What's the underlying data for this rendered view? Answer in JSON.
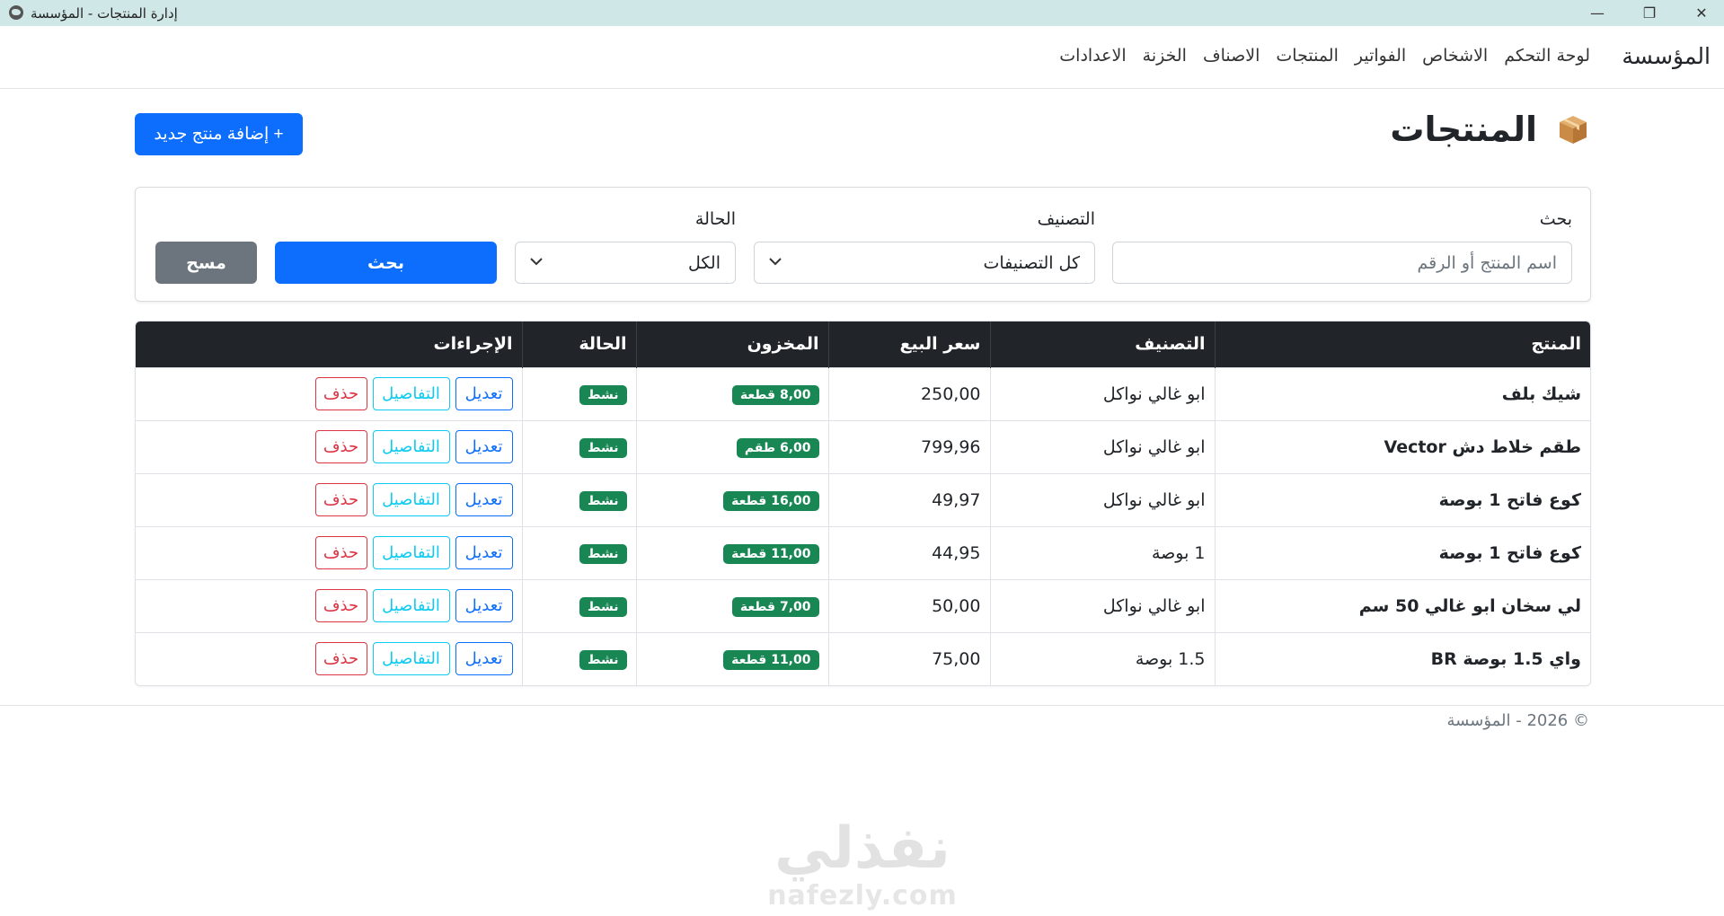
{
  "window": {
    "title": "إدارة المنتجات - المؤسسة",
    "minimize_glyph": "—",
    "maximize_glyph": "❐",
    "close_glyph": "✕"
  },
  "navbar": {
    "brand": "المؤسسة",
    "links": [
      "لوحة التحكم",
      "الاشخاص",
      "الفواتير",
      "المنتجات",
      "الاصناف",
      "الخزنة",
      "الاعدادات"
    ]
  },
  "header": {
    "icon": "package-box-icon",
    "title": "المنتجات",
    "add_button": "+ إضافة منتج جديد"
  },
  "filters": {
    "search_label": "بحث",
    "search_placeholder": "اسم المنتج أو الرقم",
    "category_label": "التصنيف",
    "category_value": "كل التصنيفات",
    "status_label": "الحالة",
    "status_value": "الكل",
    "search_button": "بحث",
    "clear_button": "مسح"
  },
  "table": {
    "headers": [
      "المنتج",
      "التصنيف",
      "سعر البيع",
      "المخزون",
      "الحالة",
      "الإجراءات"
    ],
    "rows": [
      {
        "name": "شيك بلف",
        "category": "ابو غالي نواكل",
        "price": "250,00",
        "stock": "8,00 قطعة",
        "status": "نشط"
      },
      {
        "name": "طقم خلاط دش Vector",
        "category": "ابو غالي نواكل",
        "price": "799,96",
        "stock": "6,00 طقم",
        "status": "نشط"
      },
      {
        "name": "كوع فاتح 1 بوصة",
        "category": "ابو غالي نواكل",
        "price": "49,97",
        "stock": "16,00 قطعة",
        "status": "نشط"
      },
      {
        "name": "كوع فاتح 1 بوصة",
        "category": "1 بوصة",
        "price": "44,95",
        "stock": "11,00 قطعة",
        "status": "نشط"
      },
      {
        "name": "لي سخان ابو غالي 50 سم",
        "category": "ابو غالي نواكل",
        "price": "50,00",
        "stock": "7,00 قطعة",
        "status": "نشط"
      },
      {
        "name": "واي 1.5 بوصة BR",
        "category": "1.5 بوصة",
        "price": "75,00",
        "stock": "11,00 قطعة",
        "status": "نشط"
      }
    ],
    "actions": {
      "edit": "تعديل",
      "details": "التفاصيل",
      "delete": "حذف"
    }
  },
  "footer": {
    "text": "© 2026 - المؤسسة"
  },
  "watermark": {
    "arabic": "نفذلي",
    "latin": "nafezly.com"
  },
  "colors": {
    "primary": "#0d6efd",
    "secondary": "#6c757d",
    "success": "#198754",
    "info": "#0dcaf0",
    "danger": "#dc3545",
    "dark": "#212529",
    "titlebar": "#cfe7e6"
  }
}
